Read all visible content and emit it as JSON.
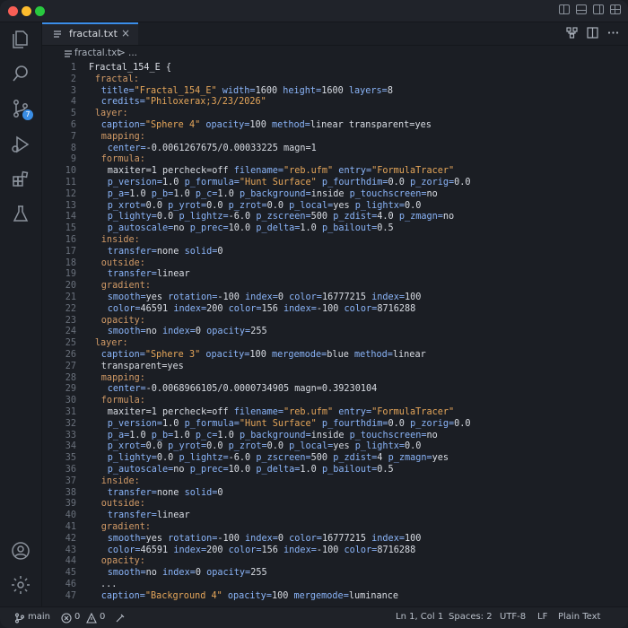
{
  "tab": {
    "label": "fractal.txt",
    "close": "×"
  },
  "breadcrumb": {
    "file": "fractal.txt",
    "sep": ">",
    "more": "..."
  },
  "activity": {
    "scm_badge": "7"
  },
  "status": {
    "branch": "main",
    "errors": "0",
    "warnings": "0",
    "cursor": "Ln 1, Col 1",
    "spaces": "Spaces: 2",
    "encoding": "UTF-8",
    "eol": "LF",
    "language": "Plain Text"
  },
  "lines": [
    {
      "n": "1",
      "indent": 0,
      "tokens": [
        [
          "plain",
          "Fractal_154_E {"
        ]
      ]
    },
    {
      "n": "2",
      "indent": 1,
      "tokens": [
        [
          "k",
          "fractal:"
        ]
      ]
    },
    {
      "n": "3",
      "indent": 2,
      "tokens": [
        [
          "a",
          "title="
        ],
        [
          "s",
          "\"Fractal_154_E\""
        ],
        [
          "a",
          " width="
        ],
        [
          "plain",
          "1600"
        ],
        [
          "a",
          " height="
        ],
        [
          "plain",
          "1600"
        ],
        [
          "a",
          " layers="
        ],
        [
          "plain",
          "8"
        ]
      ]
    },
    {
      "n": "4",
      "indent": 2,
      "tokens": [
        [
          "a",
          "credits="
        ],
        [
          "s",
          "\"Philoxerax;3/23/2026\""
        ]
      ]
    },
    {
      "n": "5",
      "indent": 1,
      "tokens": [
        [
          "k",
          "layer:"
        ]
      ]
    },
    {
      "n": "6",
      "indent": 2,
      "tokens": [
        [
          "a",
          "caption="
        ],
        [
          "s",
          "\"Sphere 4\""
        ],
        [
          "a",
          " opacity="
        ],
        [
          "plain",
          "100"
        ],
        [
          "a",
          " method="
        ],
        [
          "plain",
          "linear transparent=yes"
        ]
      ]
    },
    {
      "n": "7",
      "indent": 2,
      "tokens": [
        [
          "k",
          "mapping:"
        ]
      ]
    },
    {
      "n": "8",
      "indent": 3,
      "tokens": [
        [
          "a",
          "center="
        ],
        [
          "plain",
          "-0.0061267675/0.00033225 magn=1"
        ]
      ]
    },
    {
      "n": "9",
      "indent": 2,
      "tokens": [
        [
          "k",
          "formula:"
        ]
      ]
    },
    {
      "n": "10",
      "indent": 3,
      "tokens": [
        [
          "plain",
          "maxiter=1 percheck=off "
        ],
        [
          "a",
          "filename="
        ],
        [
          "s",
          "\"reb.ufm\""
        ],
        [
          "a",
          " entry="
        ],
        [
          "s",
          "\"FormulaTracer\""
        ]
      ]
    },
    {
      "n": "11",
      "indent": 3,
      "tokens": [
        [
          "a",
          "p_version="
        ],
        [
          "plain",
          "1.0 "
        ],
        [
          "a",
          "p_formula="
        ],
        [
          "s",
          "\"Hunt Surface\""
        ],
        [
          "a",
          " p_fourthdim="
        ],
        [
          "plain",
          "0.0 "
        ],
        [
          "a",
          "p_zorig="
        ],
        [
          "plain",
          "0.0"
        ]
      ]
    },
    {
      "n": "12",
      "indent": 3,
      "tokens": [
        [
          "a",
          "p_a="
        ],
        [
          "plain",
          "1.0 "
        ],
        [
          "a",
          "p_b="
        ],
        [
          "plain",
          "1.0 "
        ],
        [
          "a",
          "p_c="
        ],
        [
          "plain",
          "1.0 "
        ],
        [
          "a",
          "p_background="
        ],
        [
          "plain",
          "inside "
        ],
        [
          "a",
          "p_touchscreen="
        ],
        [
          "plain",
          "no"
        ]
      ]
    },
    {
      "n": "13",
      "indent": 3,
      "tokens": [
        [
          "a",
          "p_xrot="
        ],
        [
          "plain",
          "0.0 "
        ],
        [
          "a",
          "p_yrot="
        ],
        [
          "plain",
          "0.0 "
        ],
        [
          "a",
          "p_zrot="
        ],
        [
          "plain",
          "0.0 "
        ],
        [
          "a",
          "p_local="
        ],
        [
          "plain",
          "yes "
        ],
        [
          "a",
          "p_lightx="
        ],
        [
          "plain",
          "0.0"
        ]
      ]
    },
    {
      "n": "14",
      "indent": 3,
      "tokens": [
        [
          "a",
          "p_lighty="
        ],
        [
          "plain",
          "0.0 "
        ],
        [
          "a",
          "p_lightz="
        ],
        [
          "plain",
          "-6.0 "
        ],
        [
          "a",
          "p_zscreen="
        ],
        [
          "plain",
          "500 "
        ],
        [
          "a",
          "p_zdist="
        ],
        [
          "plain",
          "4.0 "
        ],
        [
          "a",
          "p_zmagn="
        ],
        [
          "plain",
          "no"
        ]
      ]
    },
    {
      "n": "15",
      "indent": 3,
      "tokens": [
        [
          "a",
          "p_autoscale="
        ],
        [
          "plain",
          "no "
        ],
        [
          "a",
          "p_prec="
        ],
        [
          "plain",
          "10.0 "
        ],
        [
          "a",
          "p_delta="
        ],
        [
          "plain",
          "1.0 "
        ],
        [
          "a",
          "p_bailout="
        ],
        [
          "plain",
          "0.5"
        ]
      ]
    },
    {
      "n": "16",
      "indent": 2,
      "tokens": [
        [
          "k",
          "inside:"
        ]
      ]
    },
    {
      "n": "17",
      "indent": 3,
      "tokens": [
        [
          "a",
          "transfer="
        ],
        [
          "plain",
          "none "
        ],
        [
          "a",
          "solid="
        ],
        [
          "plain",
          "0"
        ]
      ]
    },
    {
      "n": "18",
      "indent": 2,
      "tokens": [
        [
          "k",
          "outside:"
        ]
      ]
    },
    {
      "n": "19",
      "indent": 3,
      "tokens": [
        [
          "a",
          "transfer="
        ],
        [
          "plain",
          "linear"
        ]
      ]
    },
    {
      "n": "20",
      "indent": 2,
      "tokens": [
        [
          "k",
          "gradient:"
        ]
      ]
    },
    {
      "n": "21",
      "indent": 3,
      "tokens": [
        [
          "a",
          "smooth="
        ],
        [
          "plain",
          "yes "
        ],
        [
          "a",
          "rotation="
        ],
        [
          "plain",
          "-100 "
        ],
        [
          "a",
          "index="
        ],
        [
          "plain",
          "0 "
        ],
        [
          "a",
          "color="
        ],
        [
          "plain",
          "16777215 "
        ],
        [
          "a",
          "index="
        ],
        [
          "plain",
          "100"
        ]
      ]
    },
    {
      "n": "22",
      "indent": 3,
      "tokens": [
        [
          "a",
          "color="
        ],
        [
          "plain",
          "46591 "
        ],
        [
          "a",
          "index="
        ],
        [
          "plain",
          "200 "
        ],
        [
          "a",
          "color="
        ],
        [
          "plain",
          "156 "
        ],
        [
          "a",
          "index="
        ],
        [
          "plain",
          "-100 "
        ],
        [
          "a",
          "color="
        ],
        [
          "plain",
          "8716288"
        ]
      ]
    },
    {
      "n": "23",
      "indent": 2,
      "tokens": [
        [
          "k",
          "opacity:"
        ]
      ]
    },
    {
      "n": "24",
      "indent": 3,
      "tokens": [
        [
          "a",
          "smooth="
        ],
        [
          "plain",
          "no "
        ],
        [
          "a",
          "index="
        ],
        [
          "plain",
          "0 "
        ],
        [
          "a",
          "opacity="
        ],
        [
          "plain",
          "255"
        ]
      ]
    },
    {
      "n": "25",
      "indent": 1,
      "tokens": [
        [
          "k",
          "layer:"
        ]
      ]
    },
    {
      "n": "26",
      "indent": 2,
      "tokens": [
        [
          "a",
          "caption="
        ],
        [
          "s",
          "\"Sphere 3\""
        ],
        [
          "a",
          " opacity="
        ],
        [
          "plain",
          "100"
        ],
        [
          "a",
          " mergemode="
        ],
        [
          "plain",
          "blue "
        ],
        [
          "a",
          "method="
        ],
        [
          "plain",
          "linear"
        ]
      ]
    },
    {
      "n": "27",
      "indent": 2,
      "tokens": [
        [
          "plain",
          "transparent=yes"
        ]
      ]
    },
    {
      "n": "28",
      "indent": 2,
      "tokens": [
        [
          "k",
          "mapping:"
        ]
      ]
    },
    {
      "n": "29",
      "indent": 3,
      "tokens": [
        [
          "a",
          "center="
        ],
        [
          "plain",
          "-0.0068966105/0.0000734905 magn=0.39230104"
        ]
      ]
    },
    {
      "n": "30",
      "indent": 2,
      "tokens": [
        [
          "k",
          "formula:"
        ]
      ]
    },
    {
      "n": "31",
      "indent": 3,
      "tokens": [
        [
          "plain",
          "maxiter=1 percheck=off "
        ],
        [
          "a",
          "filename="
        ],
        [
          "s",
          "\"reb.ufm\""
        ],
        [
          "a",
          " entry="
        ],
        [
          "s",
          "\"FormulaTracer\""
        ]
      ]
    },
    {
      "n": "32",
      "indent": 3,
      "tokens": [
        [
          "a",
          "p_version="
        ],
        [
          "plain",
          "1.0 "
        ],
        [
          "a",
          "p_formula="
        ],
        [
          "s",
          "\"Hunt Surface\""
        ],
        [
          "a",
          " p_fourthdim="
        ],
        [
          "plain",
          "0.0 "
        ],
        [
          "a",
          "p_zorig="
        ],
        [
          "plain",
          "0.0"
        ]
      ]
    },
    {
      "n": "33",
      "indent": 3,
      "tokens": [
        [
          "a",
          "p_a="
        ],
        [
          "plain",
          "1.0 "
        ],
        [
          "a",
          "p_b="
        ],
        [
          "plain",
          "1.0 "
        ],
        [
          "a",
          "p_c="
        ],
        [
          "plain",
          "1.0 "
        ],
        [
          "a",
          "p_background="
        ],
        [
          "plain",
          "inside "
        ],
        [
          "a",
          "p_touchscreen="
        ],
        [
          "plain",
          "no"
        ]
      ]
    },
    {
      "n": "34",
      "indent": 3,
      "tokens": [
        [
          "a",
          "p_xrot="
        ],
        [
          "plain",
          "0.0 "
        ],
        [
          "a",
          "p_yrot="
        ],
        [
          "plain",
          "0.0 "
        ],
        [
          "a",
          "p_zrot="
        ],
        [
          "plain",
          "0.0 "
        ],
        [
          "a",
          "p_local="
        ],
        [
          "plain",
          "yes "
        ],
        [
          "a",
          "p_lightx="
        ],
        [
          "plain",
          "0.0"
        ]
      ]
    },
    {
      "n": "35",
      "indent": 3,
      "tokens": [
        [
          "a",
          "p_lighty="
        ],
        [
          "plain",
          "0.0 "
        ],
        [
          "a",
          "p_lightz="
        ],
        [
          "plain",
          "-6.0 "
        ],
        [
          "a",
          "p_zscreen="
        ],
        [
          "plain",
          "500 "
        ],
        [
          "a",
          "p_zdist="
        ],
        [
          "plain",
          "4 "
        ],
        [
          "a",
          "p_zmagn="
        ],
        [
          "plain",
          "yes"
        ]
      ]
    },
    {
      "n": "36",
      "indent": 3,
      "tokens": [
        [
          "a",
          "p_autoscale="
        ],
        [
          "plain",
          "no "
        ],
        [
          "a",
          "p_prec="
        ],
        [
          "plain",
          "10.0 "
        ],
        [
          "a",
          "p_delta="
        ],
        [
          "plain",
          "1.0 "
        ],
        [
          "a",
          "p_bailout="
        ],
        [
          "plain",
          "0.5"
        ]
      ]
    },
    {
      "n": "37",
      "indent": 2,
      "tokens": [
        [
          "k",
          "inside:"
        ]
      ]
    },
    {
      "n": "38",
      "indent": 3,
      "tokens": [
        [
          "a",
          "transfer="
        ],
        [
          "plain",
          "none "
        ],
        [
          "a",
          "solid="
        ],
        [
          "plain",
          "0"
        ]
      ]
    },
    {
      "n": "39",
      "indent": 2,
      "tokens": [
        [
          "k",
          "outside:"
        ]
      ]
    },
    {
      "n": "40",
      "indent": 3,
      "tokens": [
        [
          "a",
          "transfer="
        ],
        [
          "plain",
          "linear"
        ]
      ]
    },
    {
      "n": "41",
      "indent": 2,
      "tokens": [
        [
          "k",
          "gradient:"
        ]
      ]
    },
    {
      "n": "42",
      "indent": 3,
      "tokens": [
        [
          "a",
          "smooth="
        ],
        [
          "plain",
          "yes "
        ],
        [
          "a",
          "rotation="
        ],
        [
          "plain",
          "-100 "
        ],
        [
          "a",
          "index="
        ],
        [
          "plain",
          "0 "
        ],
        [
          "a",
          "color="
        ],
        [
          "plain",
          "16777215 "
        ],
        [
          "a",
          "index="
        ],
        [
          "plain",
          "100"
        ]
      ]
    },
    {
      "n": "43",
      "indent": 3,
      "tokens": [
        [
          "a",
          "color="
        ],
        [
          "plain",
          "46591 "
        ],
        [
          "a",
          "index="
        ],
        [
          "plain",
          "200 "
        ],
        [
          "a",
          "color="
        ],
        [
          "plain",
          "156 "
        ],
        [
          "a",
          "index="
        ],
        [
          "plain",
          "-100 "
        ],
        [
          "a",
          "color="
        ],
        [
          "plain",
          "8716288"
        ]
      ]
    },
    {
      "n": "44",
      "indent": 2,
      "tokens": [
        [
          "k",
          "opacity:"
        ]
      ]
    },
    {
      "n": "45",
      "indent": 3,
      "tokens": [
        [
          "a",
          "smooth="
        ],
        [
          "plain",
          "no "
        ],
        [
          "a",
          "index="
        ],
        [
          "plain",
          "0 "
        ],
        [
          "a",
          "opacity="
        ],
        [
          "plain",
          "255"
        ]
      ]
    },
    {
      "n": "46",
      "indent": 1,
      "tokens": [
        [
          "plain",
          " ..."
        ]
      ]
    },
    {
      "n": "47",
      "indent": 2,
      "tokens": [
        [
          "a",
          "caption="
        ],
        [
          "s",
          "\"Background 4\""
        ],
        [
          "a",
          " opacity="
        ],
        [
          "plain",
          "100"
        ],
        [
          "a",
          " mergemode="
        ],
        [
          "plain",
          "luminance"
        ]
      ]
    }
  ]
}
